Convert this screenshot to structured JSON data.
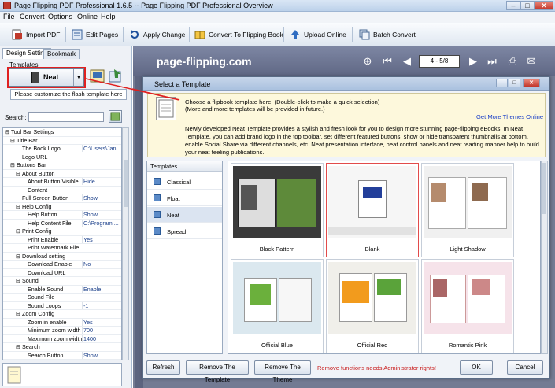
{
  "window": {
    "title": "Page Flipping PDF Professional 1.6.5  -- Page Flipping PDF Professional Overview",
    "min": "–",
    "max": "□",
    "close": "✕"
  },
  "menu": [
    "File",
    "Convert",
    "Options",
    "Online",
    "Help"
  ],
  "toolbar": {
    "import_pdf": "Import PDF",
    "edit_pages": "Edit Pages",
    "apply_change": "Apply Change",
    "convert": "Convert To Flipping Book",
    "upload": "Upload Online",
    "batch": "Batch Convert"
  },
  "left_panel": {
    "tabs": [
      "Design Setting",
      "Bookmark"
    ],
    "templates_label": "Templates",
    "template_value": "Neat",
    "customize": "Please customize the flash template here",
    "search_label": "Search:",
    "tree": [
      {
        "label": "Tool Bar Settings",
        "value": "",
        "level": 0,
        "prefix": "⊟"
      },
      {
        "label": "Title Bar",
        "value": "",
        "level": 1,
        "prefix": "⊟"
      },
      {
        "label": "The Book Logo",
        "value": "C:\\Users\\Jan...",
        "level": 2,
        "prefix": ""
      },
      {
        "label": "Logo URL",
        "value": "",
        "level": 2,
        "prefix": ""
      },
      {
        "label": "Buttons Bar",
        "value": "",
        "level": 1,
        "prefix": "⊟"
      },
      {
        "label": "About Button",
        "value": "",
        "level": 2,
        "prefix": "⊟"
      },
      {
        "label": "About Button Visible",
        "value": "Hide",
        "level": 3,
        "prefix": ""
      },
      {
        "label": "Content",
        "value": "",
        "level": 3,
        "prefix": ""
      },
      {
        "label": "Full Screen Button",
        "value": "Show",
        "level": 2,
        "prefix": ""
      },
      {
        "label": "Help Config",
        "value": "",
        "level": 2,
        "prefix": "⊟"
      },
      {
        "label": "Help Button",
        "value": "Show",
        "level": 3,
        "prefix": ""
      },
      {
        "label": "Help Content File",
        "value": "C:\\Program ...",
        "level": 3,
        "prefix": ""
      },
      {
        "label": "Print Config",
        "value": "",
        "level": 2,
        "prefix": "⊟"
      },
      {
        "label": "Print Enable",
        "value": "Yes",
        "level": 3,
        "prefix": ""
      },
      {
        "label": "Print Watermark File",
        "value": "",
        "level": 3,
        "prefix": ""
      },
      {
        "label": "Download setting",
        "value": "",
        "level": 2,
        "prefix": "⊟"
      },
      {
        "label": "Download Enable",
        "value": "No",
        "level": 3,
        "prefix": ""
      },
      {
        "label": "Download URL",
        "value": "",
        "level": 3,
        "prefix": ""
      },
      {
        "label": "Sound",
        "value": "",
        "level": 2,
        "prefix": "⊟"
      },
      {
        "label": "Enable Sound",
        "value": "Enable",
        "level": 3,
        "prefix": ""
      },
      {
        "label": "Sound File",
        "value": "",
        "level": 3,
        "prefix": ""
      },
      {
        "label": "Sound Loops",
        "value": "-1",
        "level": 3,
        "prefix": ""
      },
      {
        "label": "Zoom Config",
        "value": "",
        "level": 2,
        "prefix": "⊟"
      },
      {
        "label": "Zoom in enable",
        "value": "Yes",
        "level": 3,
        "prefix": ""
      },
      {
        "label": "Minimum zoom width",
        "value": "700",
        "level": 3,
        "prefix": ""
      },
      {
        "label": "Maximum zoom width",
        "value": "1400",
        "level": 3,
        "prefix": ""
      },
      {
        "label": "Search",
        "value": "",
        "level": 2,
        "prefix": "⊟"
      },
      {
        "label": "Search Button",
        "value": "Show",
        "level": 3,
        "prefix": ""
      }
    ]
  },
  "viewer": {
    "logo": "page-flipping.com",
    "page": "4 - 5/8"
  },
  "dialog": {
    "title": "Select a Template",
    "info_line1": "Choose a flipbook template here. (Double-click to make a quick selection)",
    "info_line2": "(More and more templates will be provided in future.)",
    "more_themes": "Get More Themes Online",
    "description": "Newly developed Neat Template provides a stylish and fresh look for you to design more stunning page-flipping eBooks. In Neat Template, you can add brand logo in the top toolbar, set different featured buttons, show or hide transparent thumbnails at bottom, enable Social Share via different channels, etc. Neat presentation interface, neat control panels and neat reading manner help to build your neat feeling publications.",
    "list_header": "Templates",
    "templates": [
      "Classical",
      "Float",
      "Neat",
      "Spread"
    ],
    "selected_template": "Neat",
    "themes": [
      "Black Pattern",
      "Blank",
      "Light Shadow",
      "Official Blue",
      "Official Red",
      "Romantic Pink"
    ],
    "buttons": {
      "refresh": "Refresh",
      "remove_template": "Remove The Template",
      "remove_theme": "Remove The Theme",
      "ok": "OK",
      "cancel": "Cancel"
    },
    "warning": "Remove functions needs Administrator rights!"
  },
  "colors": {
    "accent_red": "#e02020",
    "link_blue": "#1a3fc8",
    "viewer_bg": "#737b93"
  }
}
